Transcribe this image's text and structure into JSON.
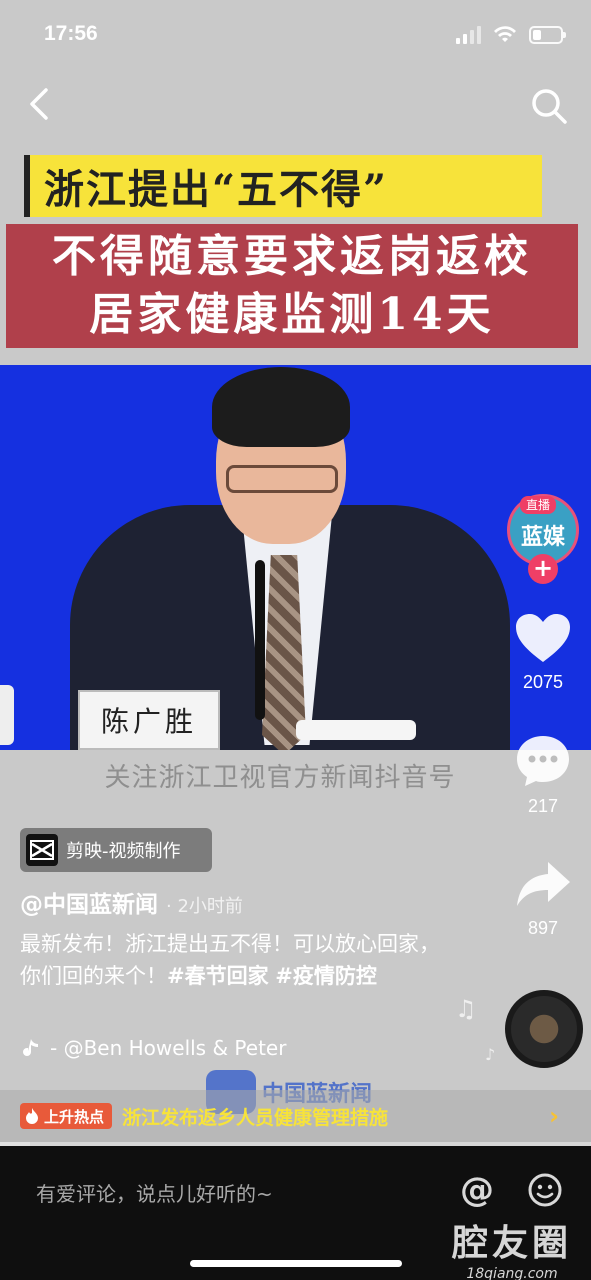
{
  "status_bar": {
    "time": "17:56"
  },
  "overlay_titles": {
    "yellow": "浙江提出“五不得”",
    "red_line1": "不得随意要求返岗返校",
    "red_line2": "居家健康监测14天"
  },
  "video": {
    "nameplate": "陈广胜",
    "watermark": "关注浙江卫视官方新闻抖音号",
    "logo_text": "中国蓝新闻"
  },
  "live": {
    "tag": "直播",
    "avatar_text": "蓝媒"
  },
  "actions": {
    "likes": "2075",
    "comments": "217",
    "shares": "897"
  },
  "capcut": {
    "label": "剪映-视频制作"
  },
  "author": {
    "name": "@中国蓝新闻",
    "time": "· 2小时前"
  },
  "caption": {
    "text": "最新发布！浙江提出五不得！可以放心回家，你们回的来个！",
    "tag1": "#春节回家",
    "tag2": "#疫情防控"
  },
  "music": {
    "text": "- @Ben Howells & Peter"
  },
  "hot": {
    "badge": "上升热点",
    "title": "浙江发布返乡人员健康管理措施"
  },
  "comment": {
    "placeholder": "有爱评论，说点儿好听的~"
  },
  "site": {
    "name": "腔友圈",
    "url": "18qiang.com"
  },
  "colors": {
    "accent_red": "#ef3f66",
    "hot_yellow": "#f7e33a",
    "title_red": "#b0404b"
  }
}
